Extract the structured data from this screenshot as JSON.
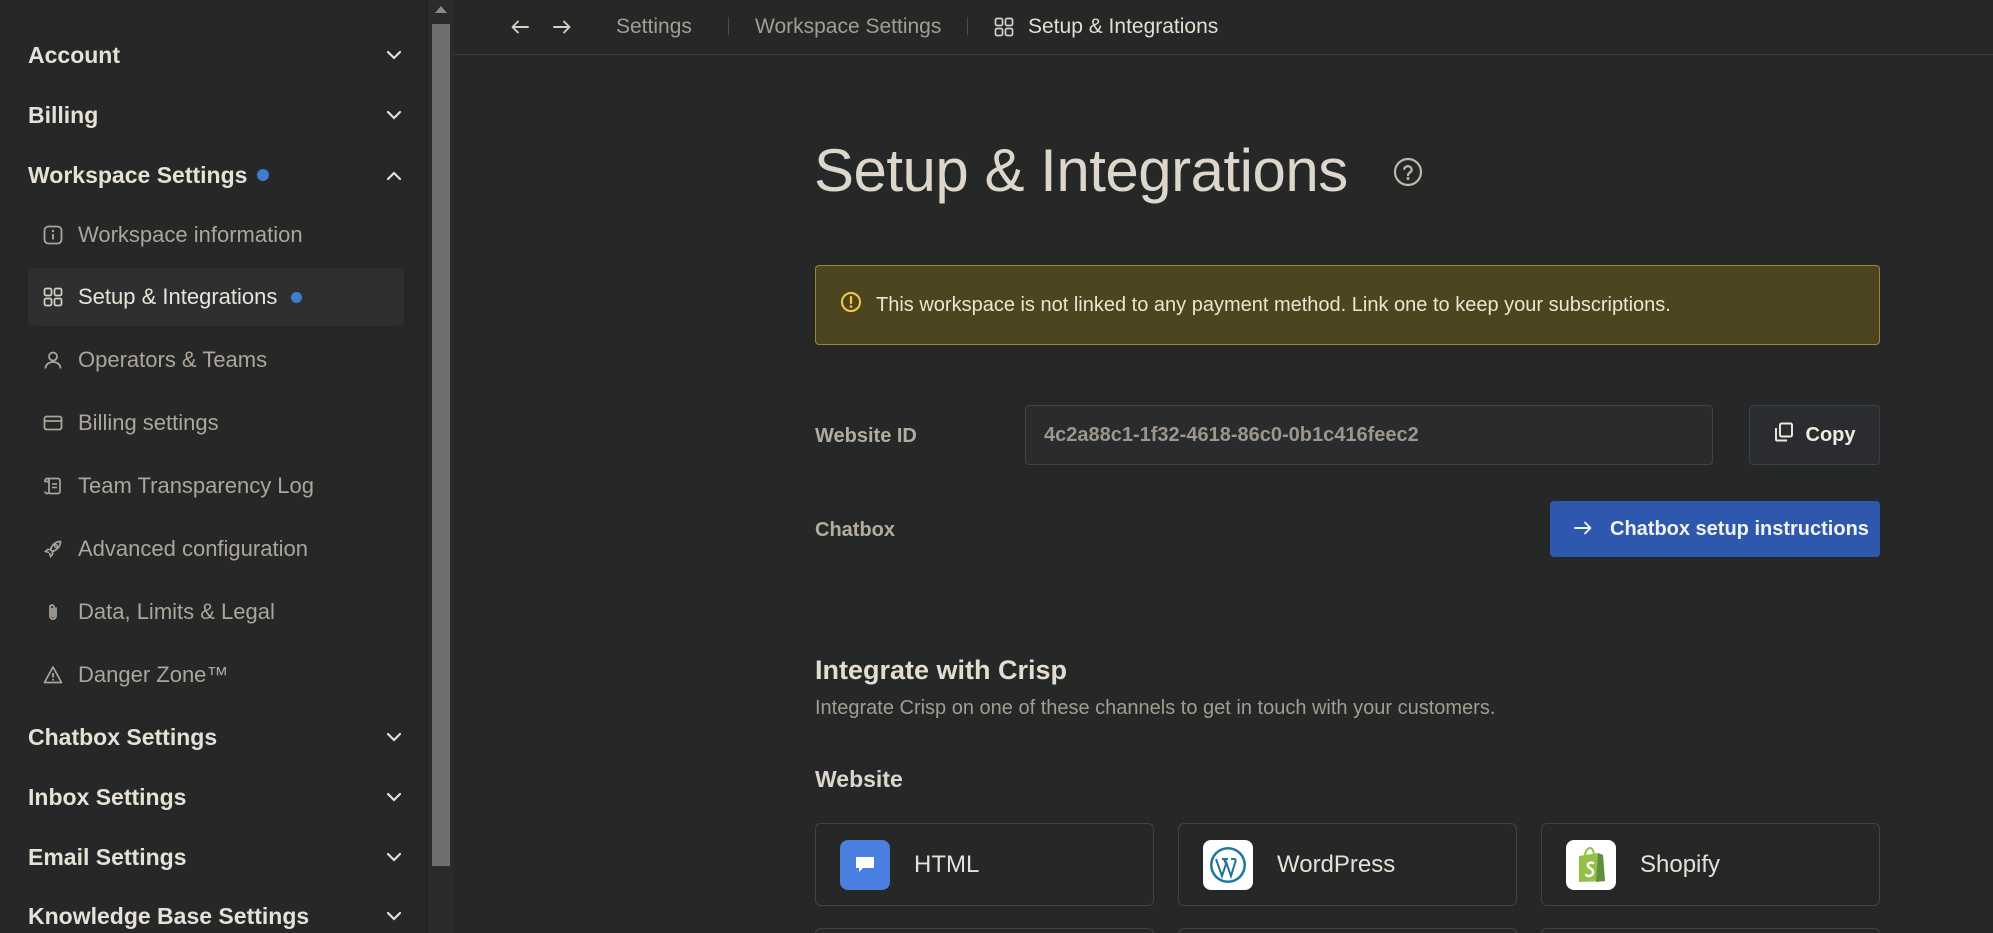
{
  "sidebar": {
    "groups": [
      {
        "label": "Account",
        "expanded": false
      },
      {
        "label": "Billing",
        "expanded": false
      },
      {
        "label": "Workspace Settings",
        "expanded": true,
        "has_dot": true
      },
      {
        "label": "Chatbox Settings",
        "expanded": false
      },
      {
        "label": "Inbox Settings",
        "expanded": false
      },
      {
        "label": "Email Settings",
        "expanded": false
      },
      {
        "label": "Knowledge Base Settings",
        "expanded": false
      }
    ],
    "workspace_items": [
      {
        "label": "Workspace information",
        "icon": "info-icon"
      },
      {
        "label": "Setup & Integrations",
        "icon": "grid-icon",
        "active": true,
        "has_dot": true
      },
      {
        "label": "Operators & Teams",
        "icon": "user-icon"
      },
      {
        "label": "Billing settings",
        "icon": "credit-card-icon"
      },
      {
        "label": "Team Transparency Log",
        "icon": "scroll-icon"
      },
      {
        "label": "Advanced configuration",
        "icon": "rocket-icon"
      },
      {
        "label": "Data, Limits & Legal",
        "icon": "paperclip-icon"
      },
      {
        "label": "Danger Zone™",
        "icon": "warning-icon"
      }
    ]
  },
  "breadcrumb": {
    "items": [
      "Settings",
      "Workspace Settings",
      "Setup & Integrations"
    ]
  },
  "main": {
    "title": "Setup & Integrations",
    "alert_text": "This workspace is not linked to any payment method. Link one to keep your subscriptions.",
    "website_id_label": "Website ID",
    "website_id_value": "4c2a88c1-1f32-4618-86c0-0b1c416feec2",
    "copy_label": "Copy",
    "chatbox_label": "Chatbox",
    "chatbox_button": "Chatbox setup instructions",
    "integrate_title": "Integrate with Crisp",
    "integrate_desc": "Integrate Crisp on one of these channels to get in touch with your customers.",
    "website_section": "Website",
    "integrations": [
      {
        "label": "HTML",
        "icon": "html-chat-icon"
      },
      {
        "label": "WordPress",
        "icon": "wordpress-icon"
      },
      {
        "label": "Shopify",
        "icon": "shopify-icon"
      }
    ]
  },
  "colors": {
    "background": "#262727",
    "accent": "#2e58ad",
    "alert_bg": "#4d4420",
    "alert_border": "#9a8534",
    "dot": "#3f7cd0"
  }
}
